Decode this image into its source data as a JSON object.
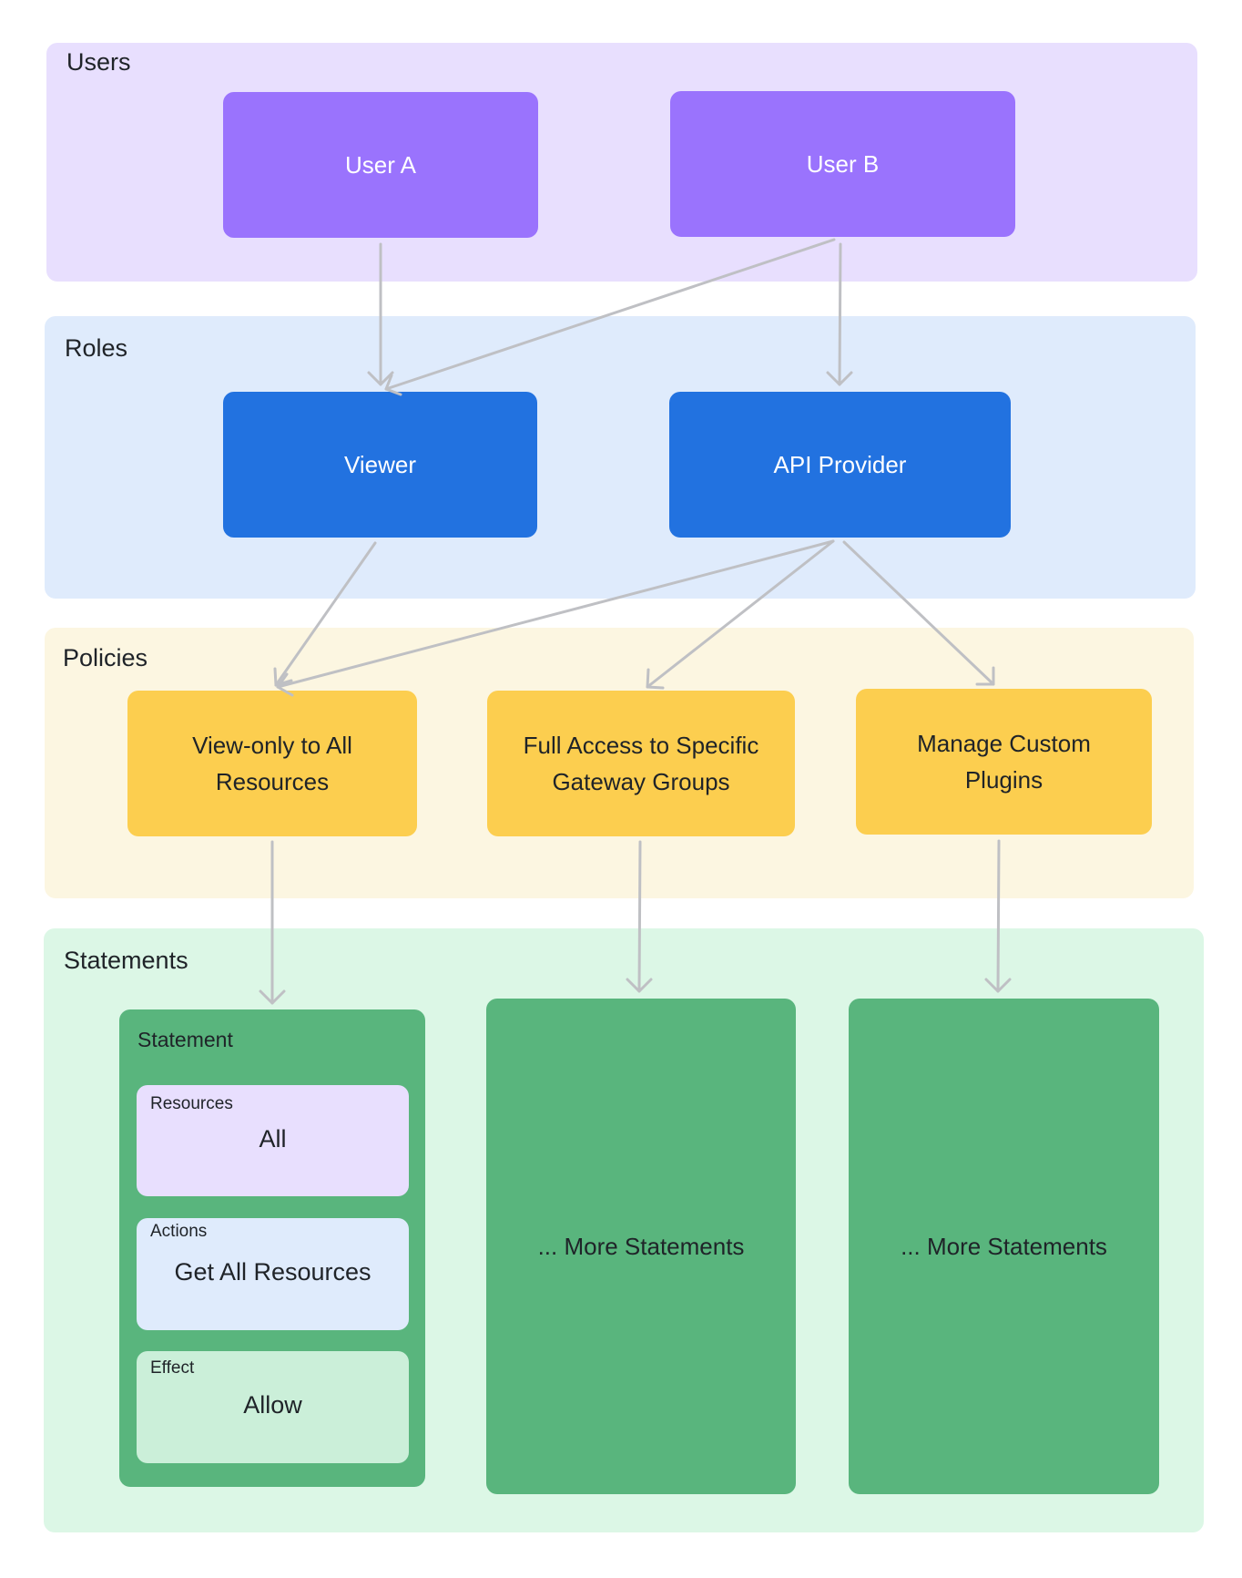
{
  "colors": {
    "users_bg": "#e8dffe",
    "roles_bg": "#dfebfc",
    "policies_bg": "#fcf6e1",
    "statements_bg": "#dcf7e6",
    "user_node": "#9a73fd",
    "role_node": "#2272e0",
    "policy_node": "#fcce4f",
    "statement_node": "#59b57d",
    "resources_field": "#e8dffe",
    "actions_field": "#dfebfc",
    "effect_field": "#cbefd9",
    "arrow": "#bfc0c4"
  },
  "sections": {
    "users": {
      "label": "Users"
    },
    "roles": {
      "label": "Roles"
    },
    "policies": {
      "label": "Policies"
    },
    "statements": {
      "label": "Statements"
    }
  },
  "users": [
    {
      "label": "User A"
    },
    {
      "label": "User B"
    }
  ],
  "roles": [
    {
      "label": "Viewer"
    },
    {
      "label": "API Provider"
    }
  ],
  "policies": [
    {
      "line1": "View-only to All",
      "line2": "Resources"
    },
    {
      "line1": "Full Access to Specific",
      "line2": "Gateway Groups"
    },
    {
      "line1": "Manage Custom",
      "line2": "Plugins"
    }
  ],
  "statement": {
    "title": "Statement",
    "fields": [
      {
        "label": "Resources",
        "value": "All"
      },
      {
        "label": "Actions",
        "value": "Get All Resources"
      },
      {
        "label": "Effect",
        "value": "Allow"
      }
    ]
  },
  "more_statements": [
    {
      "label": "... More Statements"
    },
    {
      "label": "... More Statements"
    }
  ],
  "edges": [
    {
      "from": "User A",
      "to": "Viewer"
    },
    {
      "from": "User B",
      "to": "Viewer"
    },
    {
      "from": "User B",
      "to": "API Provider"
    },
    {
      "from": "Viewer",
      "to": "View-only to All Resources"
    },
    {
      "from": "API Provider",
      "to": "View-only to All Resources"
    },
    {
      "from": "API Provider",
      "to": "Full Access to Specific Gateway Groups"
    },
    {
      "from": "API Provider",
      "to": "Manage Custom Plugins"
    },
    {
      "from": "View-only to All Resources",
      "to": "Statement"
    },
    {
      "from": "Full Access to Specific Gateway Groups",
      "to": "... More Statements"
    },
    {
      "from": "Manage Custom Plugins",
      "to": "... More Statements"
    }
  ]
}
